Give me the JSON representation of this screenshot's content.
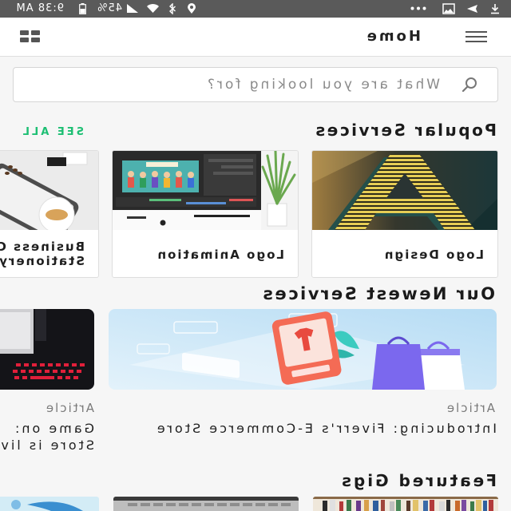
{
  "status_bar": {
    "time": "9:38 AM",
    "battery_percent": "45%",
    "notification_icons": [
      "download-icon",
      "send-icon",
      "gallery-icon",
      "more-icon"
    ],
    "system_icons": [
      "location-icon",
      "bluetooth-icon",
      "wifi-icon",
      "signal-icon",
      "battery-icon"
    ]
  },
  "header": {
    "title": "Home",
    "menu_icon": "hamburger-menu-icon",
    "layout_icon": "grid-view-icon"
  },
  "search": {
    "placeholder": "What are you looking for?",
    "icon": "search-icon"
  },
  "popular_services": {
    "title": "Popular Services",
    "see_all": "SEE ALL",
    "items": [
      {
        "label": "Logo Design",
        "image": "logo-design-image"
      },
      {
        "label": "Logo Animation",
        "image": "logo-animation-image"
      },
      {
        "label_lines": [
          "Business C",
          "Stationery"
        ],
        "image": "business-cards-image"
      }
    ]
  },
  "newest_services": {
    "title": "Our Newest Services",
    "articles": [
      {
        "tag": "Article",
        "title": "Introducing: Fiverr's E-Commerce Store",
        "image": "ecommerce-illustration"
      },
      {
        "tag": "Article",
        "title_lines": [
          "Game on:",
          "Store is liv"
        ],
        "image": "gaming-setup-image"
      }
    ]
  },
  "featured_gigs": {
    "title": "Featured Gigs",
    "items": [
      {
        "image": "bookshelf-image"
      },
      {
        "image": "laptop-image"
      },
      {
        "image": "blue-graphic-image"
      }
    ]
  },
  "colors": {
    "accent": "#1dbf73",
    "status_bar": "#5a5a5a",
    "text": "#1e1e1e",
    "muted": "#7a7a7a"
  }
}
